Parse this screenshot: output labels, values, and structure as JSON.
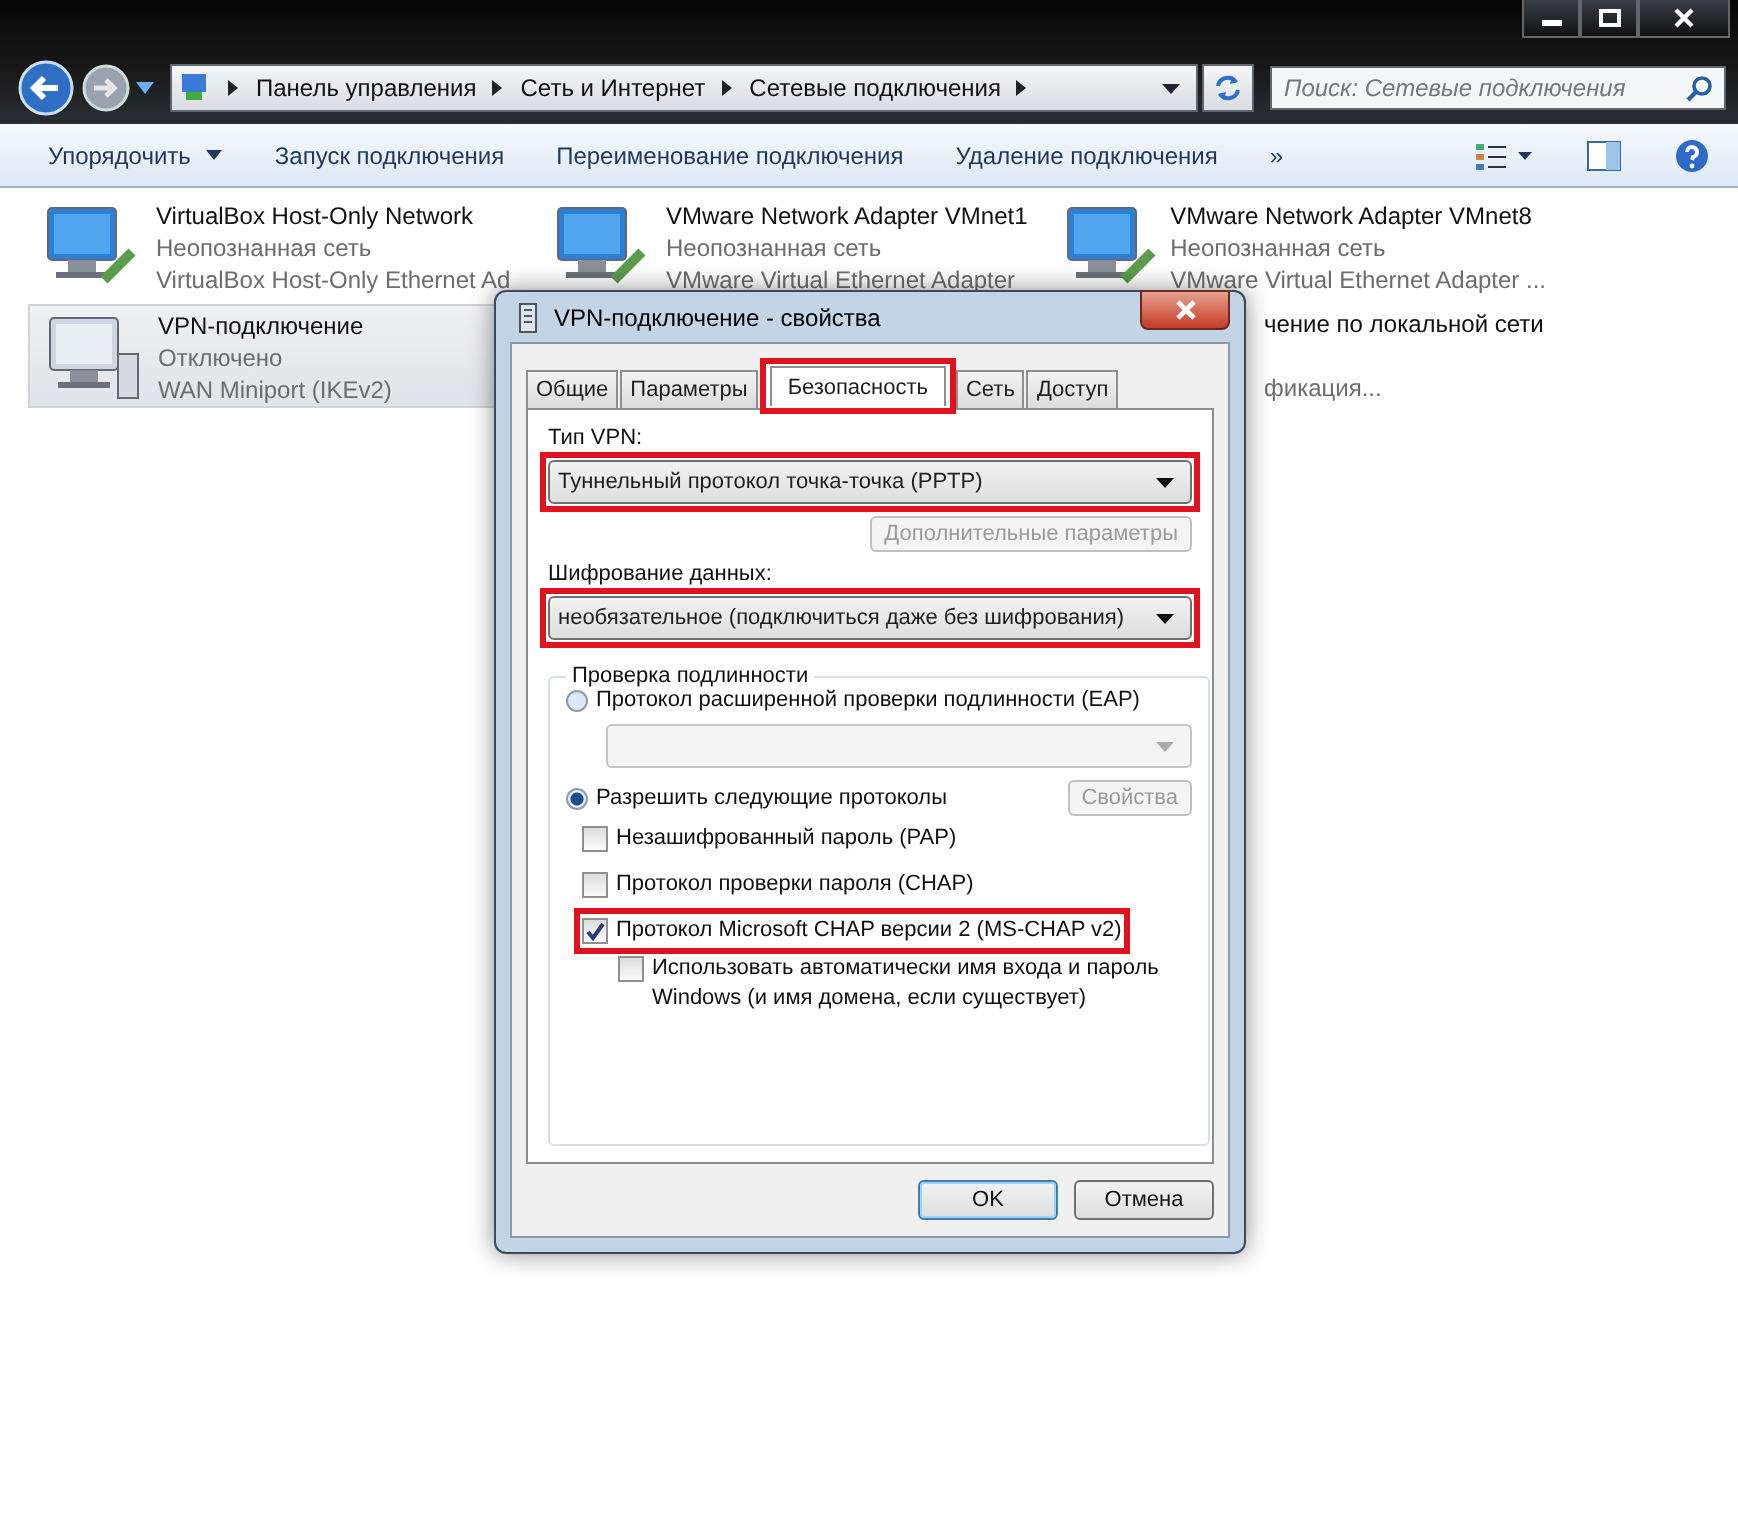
{
  "address_bar": {
    "path": [
      "Панель управления",
      "Сеть и Интернет",
      "Сетевые подключения"
    ]
  },
  "search": {
    "placeholder": "Поиск: Сетевые подключения"
  },
  "toolbar": {
    "items": [
      {
        "label": "Упорядочить",
        "dropdown": true
      },
      {
        "label": "Запуск подключения",
        "dropdown": false
      },
      {
        "label": "Переименование подключения",
        "dropdown": false
      },
      {
        "label": "Удаление подключения",
        "dropdown": false
      }
    ],
    "more": "»"
  },
  "connections": [
    {
      "kind": "full",
      "name": "VirtualBox Host-Only Network",
      "status": "Неопознанная сеть",
      "device": "VirtualBox Host-Only Ethernet Ad",
      "selected": false
    },
    {
      "kind": "full",
      "name": "VMware Network Adapter VMnet1",
      "status": "Неопознанная сеть",
      "device": "VMware Virtual Ethernet Adapter",
      "selected": false
    },
    {
      "kind": "full",
      "name": "VMware Network Adapter VMnet8",
      "status": "Неопознанная сеть",
      "device": "VMware Virtual Ethernet Adapter ...",
      "selected": false
    },
    {
      "kind": "vpn",
      "name": "VPN-подключение",
      "status": "Отключено",
      "device": "WAN Miniport (IKEv2)",
      "selected": true
    },
    {
      "kind": "spacer"
    },
    {
      "kind": "partial",
      "name": "чение по локальной сети",
      "device": "фикация...",
      "selected": false
    }
  ],
  "dialog": {
    "title": "VPN-подключение - свойства",
    "tabs": [
      {
        "label": "Общие",
        "selected": false,
        "highlighted": false
      },
      {
        "label": "Параметры",
        "selected": false,
        "highlighted": false
      },
      {
        "label": "Безопасность",
        "selected": true,
        "highlighted": true
      },
      {
        "label": "Сеть",
        "selected": false,
        "highlighted": false
      },
      {
        "label": "Доступ",
        "selected": false,
        "highlighted": false
      }
    ],
    "vpn_type": {
      "label": "Тип VPN:",
      "value": "Туннельный протокол точка-точка (PPTP)",
      "highlighted": true
    },
    "advanced_button": {
      "label": "Дополнительные параметры",
      "disabled": true
    },
    "encryption": {
      "label": "Шифрование данных:",
      "value": "необязательное (подключиться даже без шифрования)",
      "highlighted": true
    },
    "auth": {
      "title": "Проверка подлинности",
      "eap": {
        "label": "Протокол расширенной проверки подлинности (EAP)",
        "selected": false
      },
      "allow": {
        "label": "Разрешить следующие протоколы",
        "selected": true
      },
      "properties_button": {
        "label": "Свойства",
        "disabled": true
      },
      "protocols": [
        {
          "label": "Незашифрованный пароль (PAP)",
          "checked": false,
          "highlighted": false
        },
        {
          "label": "Протокол проверки пароля (CHAP)",
          "checked": false,
          "highlighted": false
        },
        {
          "label": "Протокол Microsoft CHAP версии 2 (MS-CHAP v2)",
          "checked": true,
          "highlighted": true,
          "children": [
            {
              "label": "Использовать автоматически имя входа и пароль Windows (и имя домена, если существует)",
              "checked": false
            }
          ]
        }
      ]
    },
    "buttons": [
      {
        "label": "OK",
        "default": true
      },
      {
        "label": "Отмена",
        "default": false
      }
    ]
  }
}
